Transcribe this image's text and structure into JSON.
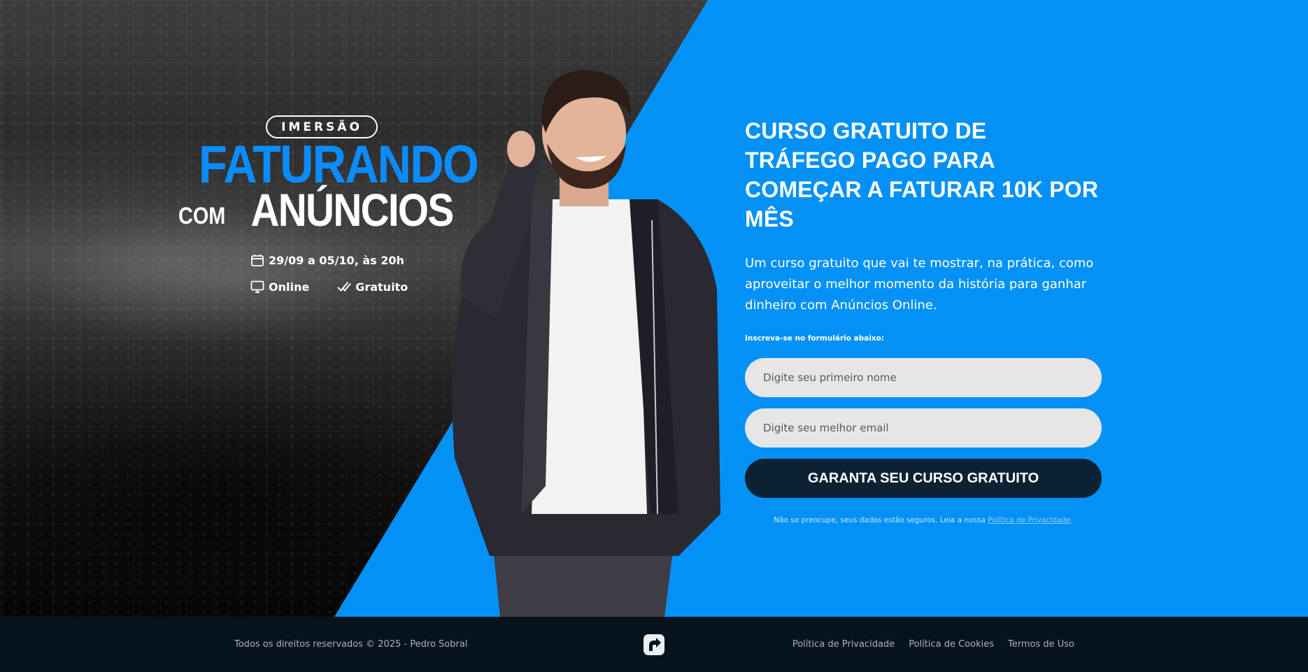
{
  "event": {
    "badge": "IMERSÃO",
    "logo_line1": "FATURANDO",
    "logo_com": "COM",
    "logo_line2": "ANÚNCIOS",
    "date": "29/09 a 05/10, às 20h",
    "mode": "Online",
    "price": "Gratuito"
  },
  "content": {
    "headline": "CURSO GRATUITO DE TRÁFEGO PAGO PARA COMEÇAR A FATURAR 10K POR MÊS",
    "subhead": "Um curso gratuito que vai te mostrar, na prática, como aproveitar o melhor momento da história para ganhar dinheiro com Anúncios Online.",
    "form_label": "Inscreva-se no formulário abaixo:",
    "name_placeholder": "Digite seu primeiro nome",
    "email_placeholder": "Digite seu melhor email",
    "cta_label": "GARANTA SEU CURSO GRATUITO",
    "privacy_text": "Não se preocupe, seus dados estão seguros. Leia a nossa ",
    "privacy_link": "Política de Privacidade",
    "privacy_end": "."
  },
  "footer": {
    "copyright": "Todos os direitos reservados © 2025 - Pedro Sobral",
    "links": [
      "Política de Privacidade",
      "Política de Cookies",
      "Termos de Uso"
    ]
  },
  "colors": {
    "brand_blue": "#0391f6",
    "logo_blue": "#0a8cff",
    "cta_dark": "#0c2233",
    "footer_bg": "#07131c"
  }
}
